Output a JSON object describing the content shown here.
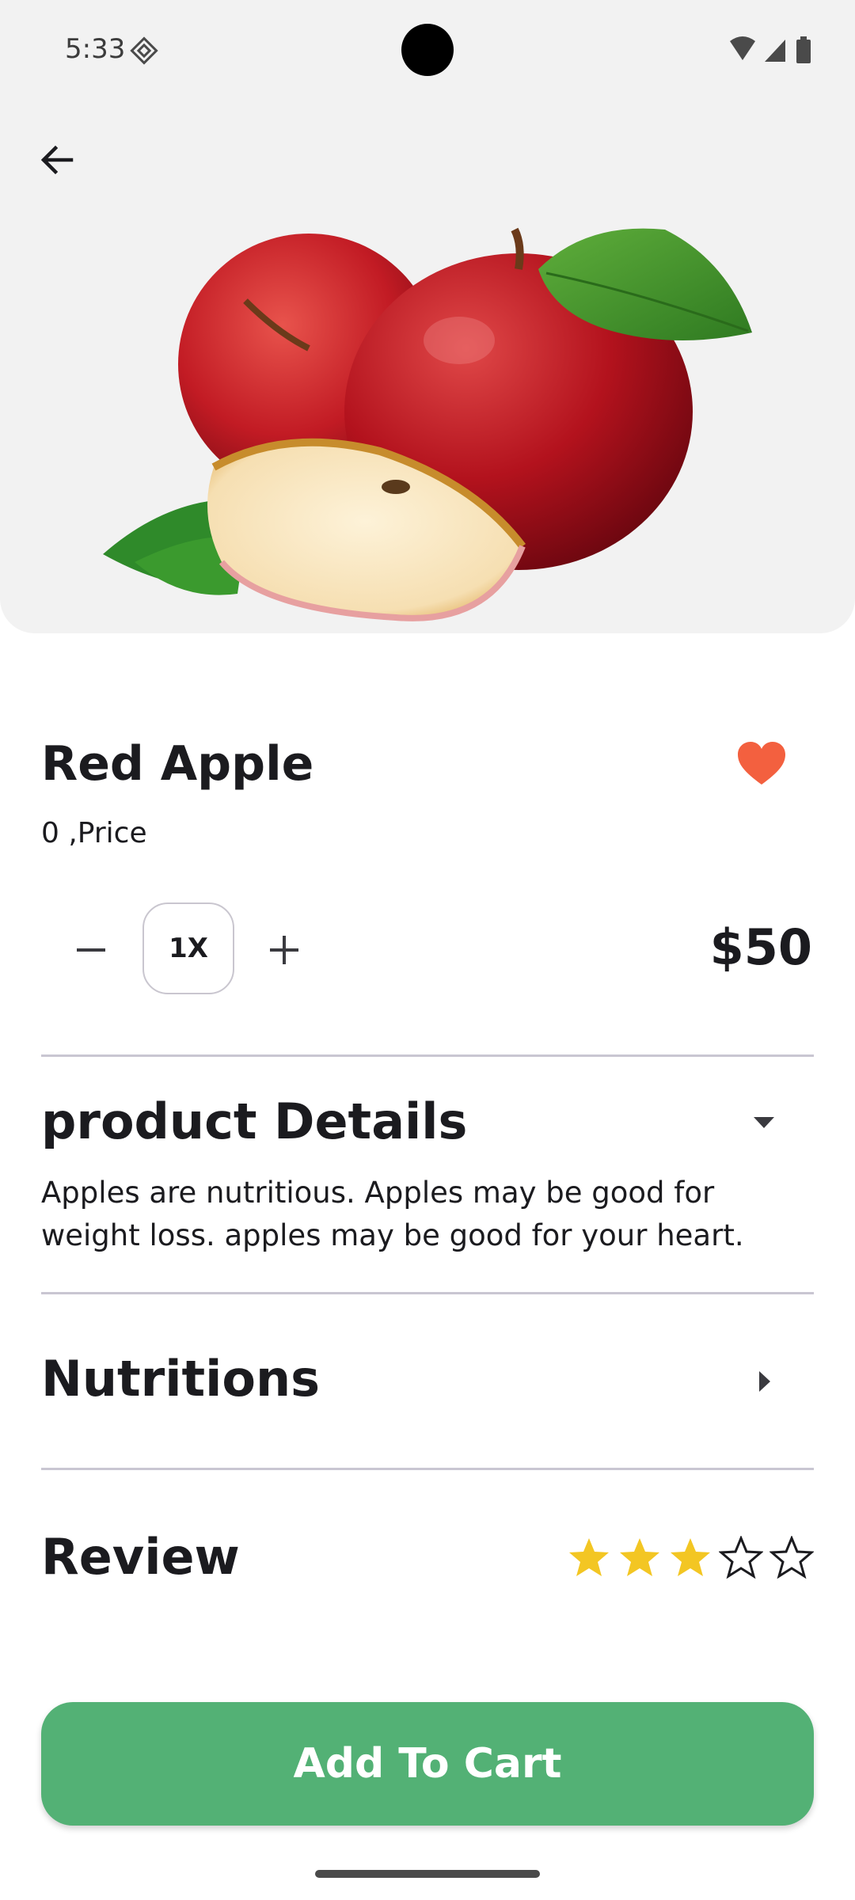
{
  "status_bar": {
    "time": "5:33"
  },
  "product": {
    "name": "Red Apple",
    "subtitle": "0 ,Price",
    "quantity_label": "1X",
    "price": "$50",
    "favorite": true
  },
  "sections": {
    "details": {
      "title": "product Details",
      "text": "Apples are nutritious. Apples may be good for weight loss. apples may be good for your heart.",
      "expanded": true
    },
    "nutritions": {
      "title": "Nutritions",
      "expanded": false
    },
    "review": {
      "title": "Review",
      "rating": 3,
      "max_rating": 5
    }
  },
  "cta": {
    "label": "Add To Cart"
  },
  "colors": {
    "accent": "#53b175",
    "heart": "#f3603f",
    "star_filled": "#f3c623",
    "hero_bg": "#f2f2f2"
  },
  "icons": [
    "back-arrow-icon",
    "heart-icon",
    "minus-icon",
    "plus-icon",
    "dropdown-arrow-icon",
    "chevron-right-icon",
    "star-icon"
  ]
}
